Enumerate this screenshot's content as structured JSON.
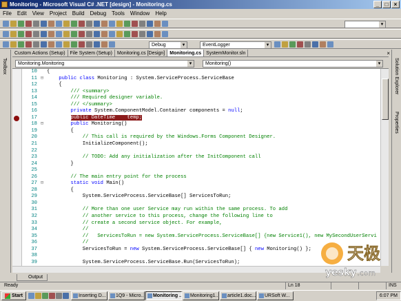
{
  "window": {
    "title": "Monitoring - Microsoft Visual C# .NET [design] - Monitoring.cs"
  },
  "menu": [
    "File",
    "Edit",
    "View",
    "Project",
    "Build",
    "Debug",
    "Tools",
    "Window",
    "Help"
  ],
  "toolbar": {
    "config": "Debug",
    "find": "EventLogger"
  },
  "tabs": [
    {
      "label": "Custom Actions (Setup)",
      "active": false
    },
    {
      "label": "File System (Setup)",
      "active": false
    },
    {
      "label": "Monitoring.cs [Design]",
      "active": false
    },
    {
      "label": "Monitoring.cs",
      "active": true
    },
    {
      "label": "SystemMonitor.sln",
      "active": false
    }
  ],
  "tab_close": "× ",
  "nav": {
    "type": "Monitoring.Monitoring",
    "member": "Monitoring()"
  },
  "left_sidebar": {
    "label": "Toolbox"
  },
  "right_sidebar": {
    "top": "Solution Explorer",
    "bottom": "Properties"
  },
  "code_lines": [
    {
      "n": "10",
      "text": "{"
    },
    {
      "n": "11",
      "text": "    public class Monitoring : System.ServiceProcess.ServiceBase"
    },
    {
      "n": "12",
      "text": "    {"
    },
    {
      "n": "13",
      "text": "        /// <summary>"
    },
    {
      "n": "14",
      "text": "        /// Required designer variable."
    },
    {
      "n": "15",
      "text": "        /// </summary>"
    },
    {
      "n": "16",
      "text": "        private System.ComponentModel.Container components = null;"
    },
    {
      "n": "17",
      "text": "        public DateTime    temp;"
    },
    {
      "n": "18",
      "text": "        public Monitoring()"
    },
    {
      "n": "19",
      "text": "        {"
    },
    {
      "n": "20",
      "text": "            // This call is required by the Windows.Forms Component Designer."
    },
    {
      "n": "21",
      "text": "            InitializeComponent();"
    },
    {
      "n": "22",
      "text": ""
    },
    {
      "n": "23",
      "text": "            // TODO: Add any initialization after the InitComponent call"
    },
    {
      "n": "24",
      "text": "        }"
    },
    {
      "n": "25",
      "text": ""
    },
    {
      "n": "26",
      "text": "        // The main entry point for the process"
    },
    {
      "n": "27",
      "text": "        static void Main()"
    },
    {
      "n": "28",
      "text": "        {"
    },
    {
      "n": "29",
      "text": "            System.ServiceProcess.ServiceBase[] ServicesToRun;"
    },
    {
      "n": "30",
      "text": ""
    },
    {
      "n": "31",
      "text": "            // More than one user Service may run within the same process. To add"
    },
    {
      "n": "32",
      "text": "            // another service to this process, change the following line to"
    },
    {
      "n": "33",
      "text": "            // create a second service object. For example,"
    },
    {
      "n": "34",
      "text": "            //"
    },
    {
      "n": "35",
      "text": "            //   ServicesToRun = new System.ServiceProcess.ServiceBase[] {new Service1(), new MySecondUserServi"
    },
    {
      "n": "36",
      "text": "            //"
    },
    {
      "n": "37",
      "text": "            ServicesToRun = new System.ServiceProcess.ServiceBase[] { new Monitoring() };"
    },
    {
      "n": "38",
      "text": ""
    },
    {
      "n": "39",
      "text": "            System.ServiceProcess.ServiceBase.Run(ServicesToRun);"
    }
  ],
  "output": {
    "label": "Output"
  },
  "status": {
    "text": "Ready",
    "ln": "Ln 18",
    "ins": "INS"
  },
  "taskbar": {
    "start": "Start",
    "tasks": [
      {
        "label": "Inserting D...",
        "active": false
      },
      {
        "label": "1Q9 - Micro...",
        "active": false
      },
      {
        "label": "Monitoring ...",
        "active": true
      },
      {
        "label": "Monitoring1....",
        "active": false
      },
      {
        "label": "article1.doc...",
        "active": false
      },
      {
        "label": "URSoft W...",
        "active": false
      }
    ],
    "time": "6:07 PM"
  },
  "watermark": {
    "cn": "天极",
    "en": "yesky",
    "dom": ".com"
  },
  "colors": {
    "title": "#0a246a",
    "breakpoint": "#8b1a1a",
    "keyword": "#0000ff",
    "comment": "#008000"
  }
}
